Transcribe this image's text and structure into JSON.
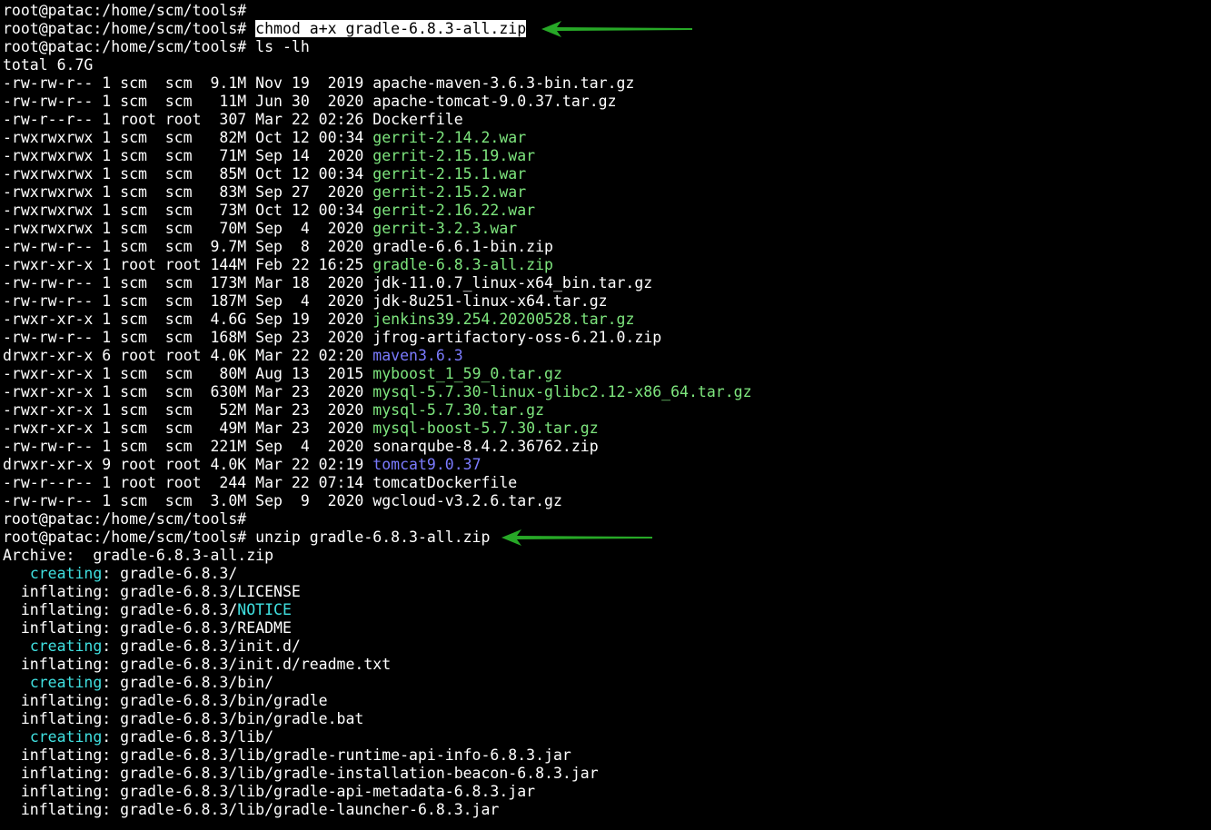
{
  "colors": {
    "background": "#000000",
    "default": "#ffffff",
    "executable": "#7ee67e",
    "directory": "#7b7bff",
    "creating": "#40e0e0",
    "notice": "#40e0e0",
    "highlight_bg": "#ffffff",
    "highlight_fg": "#000000",
    "arrow": "#27a827"
  },
  "terminal": {
    "lines": [
      [
        {
          "t": "root@patac:/home/scm/tools#",
          "c": "default"
        }
      ],
      [
        {
          "t": "root@patac:/home/scm/tools# ",
          "c": "default"
        },
        {
          "t": "chmod a+x gradle-6.8.3-all.zip",
          "c": "highlight"
        }
      ],
      [
        {
          "t": "root@patac:/home/scm/tools# ls -lh",
          "c": "default"
        }
      ],
      [
        {
          "t": "total 6.7G",
          "c": "default"
        }
      ],
      [
        {
          "t": "-rw-rw-r-- 1 scm  scm  9.1M Nov 19  2019 apache-maven-3.6.3-bin.tar.gz",
          "c": "default"
        }
      ],
      [
        {
          "t": "-rw-rw-r-- 1 scm  scm   11M Jun 30  2020 apache-tomcat-9.0.37.tar.gz",
          "c": "default"
        }
      ],
      [
        {
          "t": "-rw-r--r-- 1 root root  307 Mar 22 02:26 Dockerfile",
          "c": "default"
        }
      ],
      [
        {
          "t": "-rwxrwxrwx 1 scm  scm   82M Oct 12 00:34 ",
          "c": "default"
        },
        {
          "t": "gerrit-2.14.2.war",
          "c": "executable"
        }
      ],
      [
        {
          "t": "-rwxrwxrwx 1 scm  scm   71M Sep 14  2020 ",
          "c": "default"
        },
        {
          "t": "gerrit-2.15.19.war",
          "c": "executable"
        }
      ],
      [
        {
          "t": "-rwxrwxrwx 1 scm  scm   85M Oct 12 00:34 ",
          "c": "default"
        },
        {
          "t": "gerrit-2.15.1.war",
          "c": "executable"
        }
      ],
      [
        {
          "t": "-rwxrwxrwx 1 scm  scm   83M Sep 27  2020 ",
          "c": "default"
        },
        {
          "t": "gerrit-2.15.2.war",
          "c": "executable"
        }
      ],
      [
        {
          "t": "-rwxrwxrwx 1 scm  scm   73M Oct 12 00:34 ",
          "c": "default"
        },
        {
          "t": "gerrit-2.16.22.war",
          "c": "executable"
        }
      ],
      [
        {
          "t": "-rwxrwxrwx 1 scm  scm   70M Sep  4  2020 ",
          "c": "default"
        },
        {
          "t": "gerrit-3.2.3.war",
          "c": "executable"
        }
      ],
      [
        {
          "t": "-rw-rw-r-- 1 scm  scm  9.7M Sep  8  2020 gradle-6.6.1-bin.zip",
          "c": "default"
        }
      ],
      [
        {
          "t": "-rwxr-xr-x 1 root root 144M Feb 22 16:25 ",
          "c": "default"
        },
        {
          "t": "gradle-6.8.3-all.zip",
          "c": "executable"
        }
      ],
      [
        {
          "t": "-rw-rw-r-- 1 scm  scm  173M Mar 18  2020 jdk-11.0.7_linux-x64_bin.tar.gz",
          "c": "default"
        }
      ],
      [
        {
          "t": "-rw-rw-r-- 1 scm  scm  187M Sep  4  2020 jdk-8u251-linux-x64.tar.gz",
          "c": "default"
        }
      ],
      [
        {
          "t": "-rwxr-xr-x 1 scm  scm  4.6G Sep 19  2020 ",
          "c": "default"
        },
        {
          "t": "jenkins39.254.20200528.tar.gz",
          "c": "executable"
        }
      ],
      [
        {
          "t": "-rw-rw-r-- 1 scm  scm  168M Sep 23  2020 jfrog-artifactory-oss-6.21.0.zip",
          "c": "default"
        }
      ],
      [
        {
          "t": "drwxr-xr-x 6 root root 4.0K Mar 22 02:20 ",
          "c": "default"
        },
        {
          "t": "maven3.6.3",
          "c": "directory"
        }
      ],
      [
        {
          "t": "-rwxr-xr-x 1 scm  scm   80M Aug 13  2015 ",
          "c": "default"
        },
        {
          "t": "myboost_1_59_0.tar.gz",
          "c": "executable"
        }
      ],
      [
        {
          "t": "-rwxr-xr-x 1 scm  scm  630M Mar 23  2020 ",
          "c": "default"
        },
        {
          "t": "mysql-5.7.30-linux-glibc2.12-x86_64.tar.gz",
          "c": "executable"
        }
      ],
      [
        {
          "t": "-rwxr-xr-x 1 scm  scm   52M Mar 23  2020 ",
          "c": "default"
        },
        {
          "t": "mysql-5.7.30.tar.gz",
          "c": "executable"
        }
      ],
      [
        {
          "t": "-rwxr-xr-x 1 scm  scm   49M Mar 23  2020 ",
          "c": "default"
        },
        {
          "t": "mysql-boost-5.7.30.tar.gz",
          "c": "executable"
        }
      ],
      [
        {
          "t": "-rw-rw-r-- 1 scm  scm  221M Sep  4  2020 sonarqube-8.4.2.36762.zip",
          "c": "default"
        }
      ],
      [
        {
          "t": "drwxr-xr-x 9 root root 4.0K Mar 22 02:19 ",
          "c": "default"
        },
        {
          "t": "tomcat9.0.37",
          "c": "directory"
        }
      ],
      [
        {
          "t": "-rw-r--r-- 1 root root  244 Mar 22 07:14 tomcatDockerfile",
          "c": "default"
        }
      ],
      [
        {
          "t": "-rw-rw-r-- 1 scm  scm  3.0M Sep  9  2020 wgcloud-v3.2.6.tar.gz",
          "c": "default"
        }
      ],
      [
        {
          "t": "root@patac:/home/scm/tools#",
          "c": "default"
        }
      ],
      [
        {
          "t": "root@patac:/home/scm/tools# unzip gradle-6.8.3-all.zip",
          "c": "default"
        }
      ],
      [
        {
          "t": "Archive:  gradle-6.8.3-all.zip",
          "c": "default"
        }
      ],
      [
        {
          "t": "   ",
          "c": "default"
        },
        {
          "t": "creating",
          "c": "creating"
        },
        {
          "t": ": gradle-6.8.3/",
          "c": "default"
        }
      ],
      [
        {
          "t": "  inflating: gradle-6.8.3/LICENSE",
          "c": "default"
        }
      ],
      [
        {
          "t": "  inflating: gradle-6.8.3/",
          "c": "default"
        },
        {
          "t": "NOTICE",
          "c": "notice"
        }
      ],
      [
        {
          "t": "  inflating: gradle-6.8.3/README",
          "c": "default"
        }
      ],
      [
        {
          "t": "   ",
          "c": "default"
        },
        {
          "t": "creating",
          "c": "creating"
        },
        {
          "t": ": gradle-6.8.3/init.d/",
          "c": "default"
        }
      ],
      [
        {
          "t": "  inflating: gradle-6.8.3/init.d/readme.txt",
          "c": "default"
        }
      ],
      [
        {
          "t": "   ",
          "c": "default"
        },
        {
          "t": "creating",
          "c": "creating"
        },
        {
          "t": ": gradle-6.8.3/bin/",
          "c": "default"
        }
      ],
      [
        {
          "t": "  inflating: gradle-6.8.3/bin/gradle",
          "c": "default"
        }
      ],
      [
        {
          "t": "  inflating: gradle-6.8.3/bin/gradle.bat",
          "c": "default"
        }
      ],
      [
        {
          "t": "   ",
          "c": "default"
        },
        {
          "t": "creating",
          "c": "creating"
        },
        {
          "t": ": gradle-6.8.3/lib/",
          "c": "default"
        }
      ],
      [
        {
          "t": "  inflating: gradle-6.8.3/lib/gradle-runtime-api-info-6.8.3.jar",
          "c": "default"
        }
      ],
      [
        {
          "t": "  inflating: gradle-6.8.3/lib/gradle-installation-beacon-6.8.3.jar",
          "c": "default"
        }
      ],
      [
        {
          "t": "  inflating: gradle-6.8.3/lib/gradle-api-metadata-6.8.3.jar",
          "c": "default"
        }
      ],
      [
        {
          "t": "  inflating: gradle-6.8.3/lib/gradle-launcher-6.8.3.jar",
          "c": "default"
        }
      ]
    ]
  },
  "annotations": {
    "arrows": [
      "arrow-chmod",
      "arrow-unzip"
    ]
  }
}
